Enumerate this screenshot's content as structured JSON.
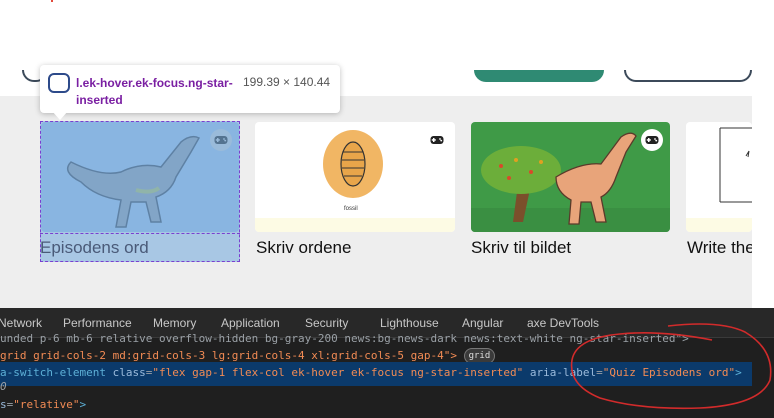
{
  "tooltip": {
    "selector": "l.ek-hover.ek-focus.ng-star-inserted",
    "size": "199.39 × 140.44"
  },
  "cards": [
    {
      "label": "Episodens ord"
    },
    {
      "label": "Skriv ordene",
      "image_text": "fossil"
    },
    {
      "label": "Skriv til bildet"
    },
    {
      "label": "Write the"
    }
  ],
  "devtools": {
    "tabs": [
      "Network",
      "Performance",
      "Memory",
      "Application",
      "Security",
      "Lighthouse",
      "Angular",
      "axe DevTools"
    ],
    "lines": {
      "line0": "unded p-6 mb-6 relative overflow-hidden bg-gray-200 news:bg-news-dark news:text-white ng-star-inserted\">",
      "line1_pre": "grid grid-cols-2 md:grid-cols-3 lg:grid-cols-4 xl:grid-cols-5 gap-4\">",
      "line1_badge": "grid",
      "line2_a": "a-switch-element ",
      "line2_attr1": "class",
      "line2_val1": "\"flex gap-1 flex-col ek-hover ek-focus ng-star-inserted\"",
      "line2_attr2": " aria-label",
      "line2_val2": "\"Quiz Episodens ord\"",
      "line2_end": ">",
      "line3": "0",
      "line4_attr": "s",
      "line4_val": "\"relative\"",
      "line4_end": ">"
    }
  },
  "colors": {
    "highlight_fill": "#a9c6e6",
    "highlight_border": "#7a3fd0",
    "devtools_bg": "#1f1f1f",
    "selected_row": "#0b3a6b",
    "annotation_circle": "#d22b2b"
  }
}
